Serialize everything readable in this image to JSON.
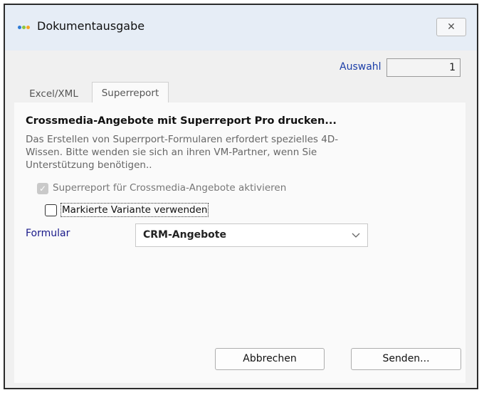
{
  "window": {
    "title": "Dokumentausgabe",
    "close_glyph": "✕"
  },
  "app_icon": {
    "name": "app-dots-icon",
    "colors": [
      "#2e7bd6",
      "#8cc63f",
      "#f6a623"
    ]
  },
  "auswahl": {
    "label": "Auswahl",
    "value": "1"
  },
  "tabs": [
    {
      "label": "Excel/XML",
      "active": false
    },
    {
      "label": "Superreport",
      "active": true
    }
  ],
  "superreport": {
    "heading": "Crossmedia-Angebote mit Superreport Pro drucken...",
    "description": "Das Erstellen von Superrport-Formularen erfordert spezielles 4D-Wissen. Bitte wenden sie sich an ihren VM-Partner, wenn Sie Unterstützung benötigen..",
    "activate_checkbox": {
      "label": "Superreport für Crossmedia-Angebote aktivieren",
      "checked": true,
      "enabled": false
    },
    "variant_checkbox": {
      "label": "Markierte Variante verwenden",
      "checked": false
    },
    "formular": {
      "label": "Formular",
      "selected": "CRM-Angebote"
    }
  },
  "buttons": {
    "cancel": "Abbrechen",
    "send": "Senden..."
  },
  "colors": {
    "accent_label": "#1a3da8",
    "titlebar": "#e6edf6"
  }
}
